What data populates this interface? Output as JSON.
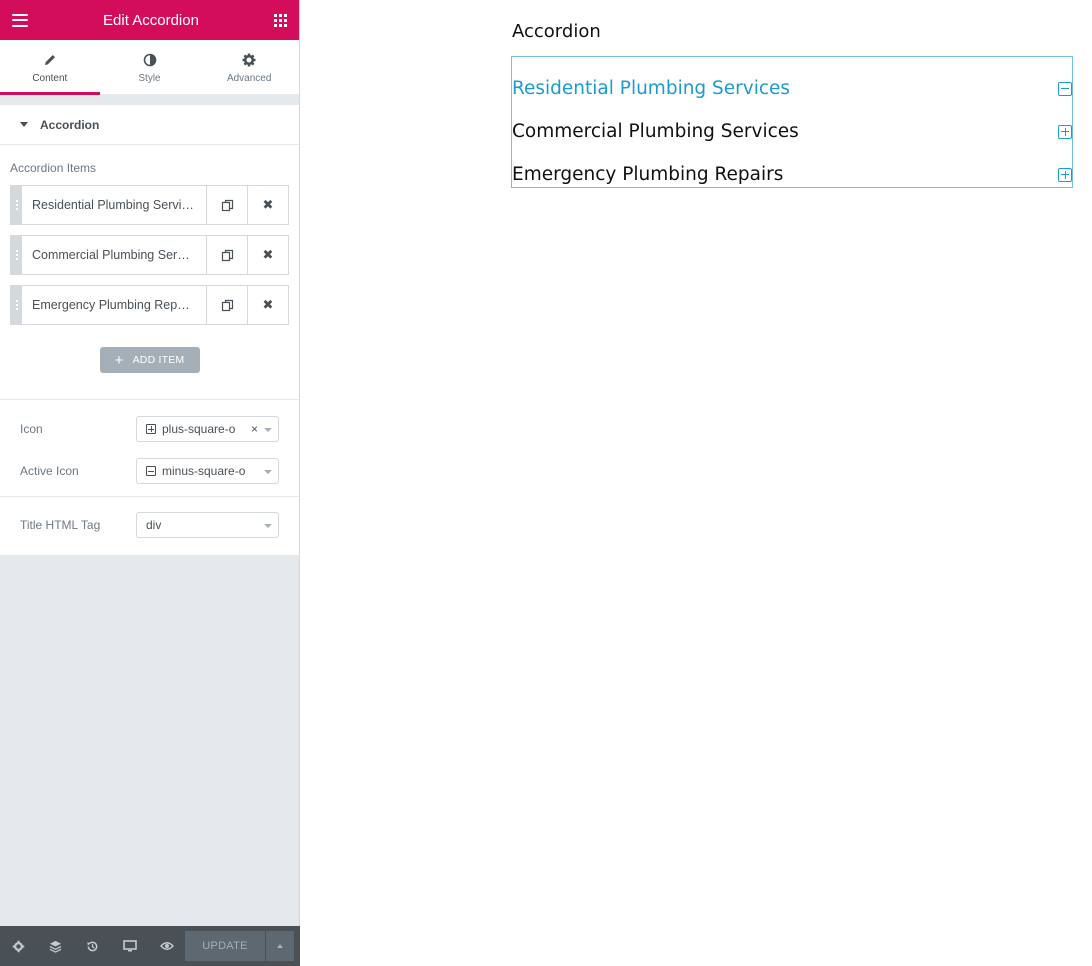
{
  "header": {
    "title": "Edit Accordion",
    "menu_icon": "hamburger-icon",
    "apps_icon": "grid-icon"
  },
  "tabs": [
    {
      "label": "Content",
      "icon": "pencil-icon",
      "active": true
    },
    {
      "label": "Style",
      "icon": "half-circle-icon",
      "active": false
    },
    {
      "label": "Advanced",
      "icon": "gear-icon",
      "active": false
    }
  ],
  "section": {
    "title": "Accordion"
  },
  "repeater": {
    "label": "Accordion Items",
    "items": [
      {
        "title": "Residential Plumbing Services"
      },
      {
        "title": "Commercial Plumbing Services"
      },
      {
        "title": "Emergency Plumbing Repairs"
      }
    ],
    "add_label": "ADD ITEM"
  },
  "controls": {
    "icon_label": "Icon",
    "icon_value": "plus-square-o",
    "active_icon_label": "Active Icon",
    "active_icon_value": "minus-square-o",
    "title_tag_label": "Title HTML Tag",
    "title_tag_value": "div"
  },
  "footer": {
    "update_label": "UPDATE"
  },
  "preview": {
    "heading": "Accordion",
    "items": [
      {
        "title": "Residential Plumbing Services",
        "active": true
      },
      {
        "title": "Commercial Plumbing Services",
        "active": false
      },
      {
        "title": "Emergency Plumbing Repairs",
        "active": false
      }
    ]
  },
  "colors": {
    "brand": "#d30c5c",
    "accent": "#1a9cd1",
    "accordion_border": "#6ec1e4"
  }
}
